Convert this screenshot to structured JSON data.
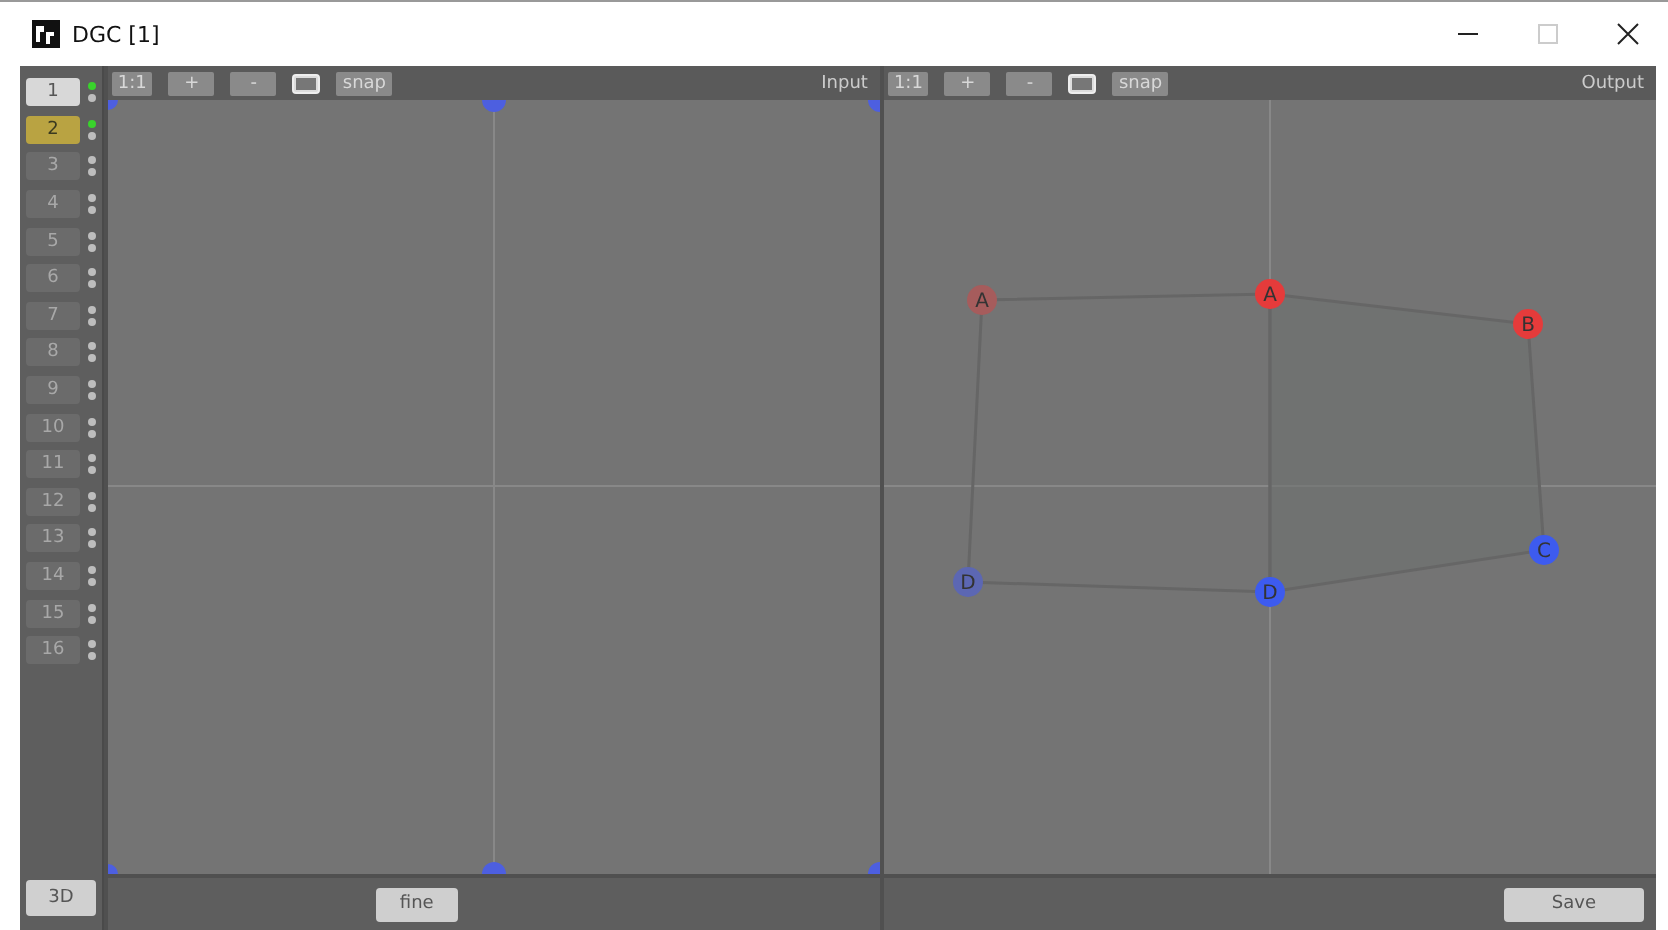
{
  "window": {
    "title": "DGC [1]",
    "maximize_disabled": true
  },
  "channels": [
    {
      "label": "1",
      "selected": false,
      "enabled": true,
      "active": true
    },
    {
      "label": "2",
      "selected": true,
      "enabled": true,
      "active": true
    },
    {
      "label": "3",
      "selected": false,
      "enabled": false,
      "active": false
    },
    {
      "label": "4",
      "selected": false,
      "enabled": false,
      "active": false
    },
    {
      "label": "5",
      "selected": false,
      "enabled": false,
      "active": false
    },
    {
      "label": "6",
      "selected": false,
      "enabled": false,
      "active": false
    },
    {
      "label": "7",
      "selected": false,
      "enabled": false,
      "active": false
    },
    {
      "label": "8",
      "selected": false,
      "enabled": false,
      "active": false
    },
    {
      "label": "9",
      "selected": false,
      "enabled": false,
      "active": false
    },
    {
      "label": "10",
      "selected": false,
      "enabled": false,
      "active": false
    },
    {
      "label": "11",
      "selected": false,
      "enabled": false,
      "active": false
    },
    {
      "label": "12",
      "selected": false,
      "enabled": false,
      "active": false
    },
    {
      "label": "13",
      "selected": false,
      "enabled": false,
      "active": false
    },
    {
      "label": "14",
      "selected": false,
      "enabled": false,
      "active": false
    },
    {
      "label": "15",
      "selected": false,
      "enabled": false,
      "active": false
    },
    {
      "label": "16",
      "selected": false,
      "enabled": false,
      "active": false
    }
  ],
  "sidebar_button": "3D",
  "panels": [
    {
      "toolbar": {
        "zoom_reset": "1:1",
        "zoom_in": "+",
        "zoom_out": "-",
        "snap": "snap"
      },
      "label": "Input",
      "footer_button": "fine"
    },
    {
      "toolbar": {
        "zoom_reset": "1:1",
        "zoom_in": "+",
        "zoom_out": "-",
        "snap": "snap"
      },
      "label": "Output",
      "footer_button": "Save",
      "points": [
        {
          "label": "A",
          "color": "#a65c5c"
        },
        {
          "label": "A",
          "color": "#e53b3b"
        },
        {
          "label": "B",
          "color": "#e53b3b"
        },
        {
          "label": "C",
          "color": "#3d5bef"
        },
        {
          "label": "D",
          "color": "#3d5bef"
        },
        {
          "label": "D",
          "color": "#5c67b3"
        }
      ]
    }
  ]
}
